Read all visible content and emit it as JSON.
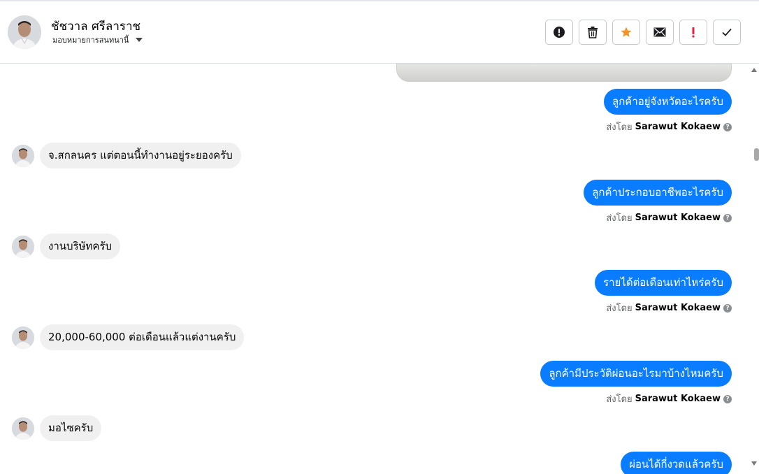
{
  "header": {
    "contact_name": "ชัชวาล ศรีลาราช",
    "assign_label": "มอบหมายการสนทนานี้",
    "avatar_icon": "person-avatar-icon",
    "actions": [
      {
        "name": "alert-circle-icon",
        "label": "!"
      },
      {
        "name": "trash-icon"
      },
      {
        "name": "star-icon",
        "color": "#f0952d"
      },
      {
        "name": "envelope-icon"
      },
      {
        "name": "important-icon",
        "label": "!",
        "color": "#e41e3f"
      },
      {
        "name": "check-icon"
      }
    ]
  },
  "colors": {
    "outgoing_bubble": "#0a7cff",
    "incoming_bubble": "#f0f0f0"
  },
  "messages": {
    "sent_by_prefix": "ส่งโดย",
    "agent_name": "Sarawut Kokaew",
    "out1": "ลูกค้าอยู่จังหวัดอะไรครับ",
    "in1": "จ.สกลนคร แต่ตอนนี้ทำงานอยู่ระยองครับ",
    "out2": "ลูกค้าประกอบอาชีพอะไรครับ",
    "in2": "งานบริษัทครับ",
    "out3": "รายได้ต่อเดือนเท่าไหร่ครับ",
    "in3": "20,000-60,000 ต่อเดือนแล้วแต่งานครับ",
    "out4": "ลูกค้ามีประวัติผ่อนอะไรมาบ้างไหมครับ",
    "in4": "มอไซครับ",
    "out5": "ผ่อนได้กี่งวดแล้วครับ"
  }
}
